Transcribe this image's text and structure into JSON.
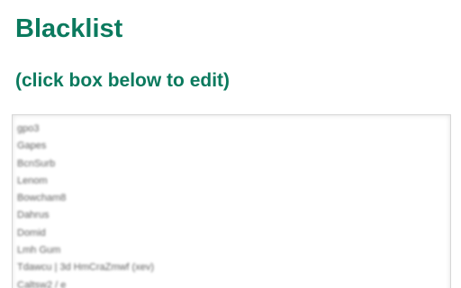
{
  "page": {
    "title": "Blacklist",
    "subtitle": "(click box below to edit)",
    "accent_color": "#0b7a5e"
  },
  "blacklist_box": {
    "lines": [
      "gpo3",
      "Gapes",
      "BcnSurb",
      "Lenom",
      "Bowcham8",
      "Dahrus",
      "Domid",
      "Lmh Gum",
      "Tdawcu | 3d HmCraZmwf (xev)",
      "Caltsw2 / e"
    ]
  }
}
